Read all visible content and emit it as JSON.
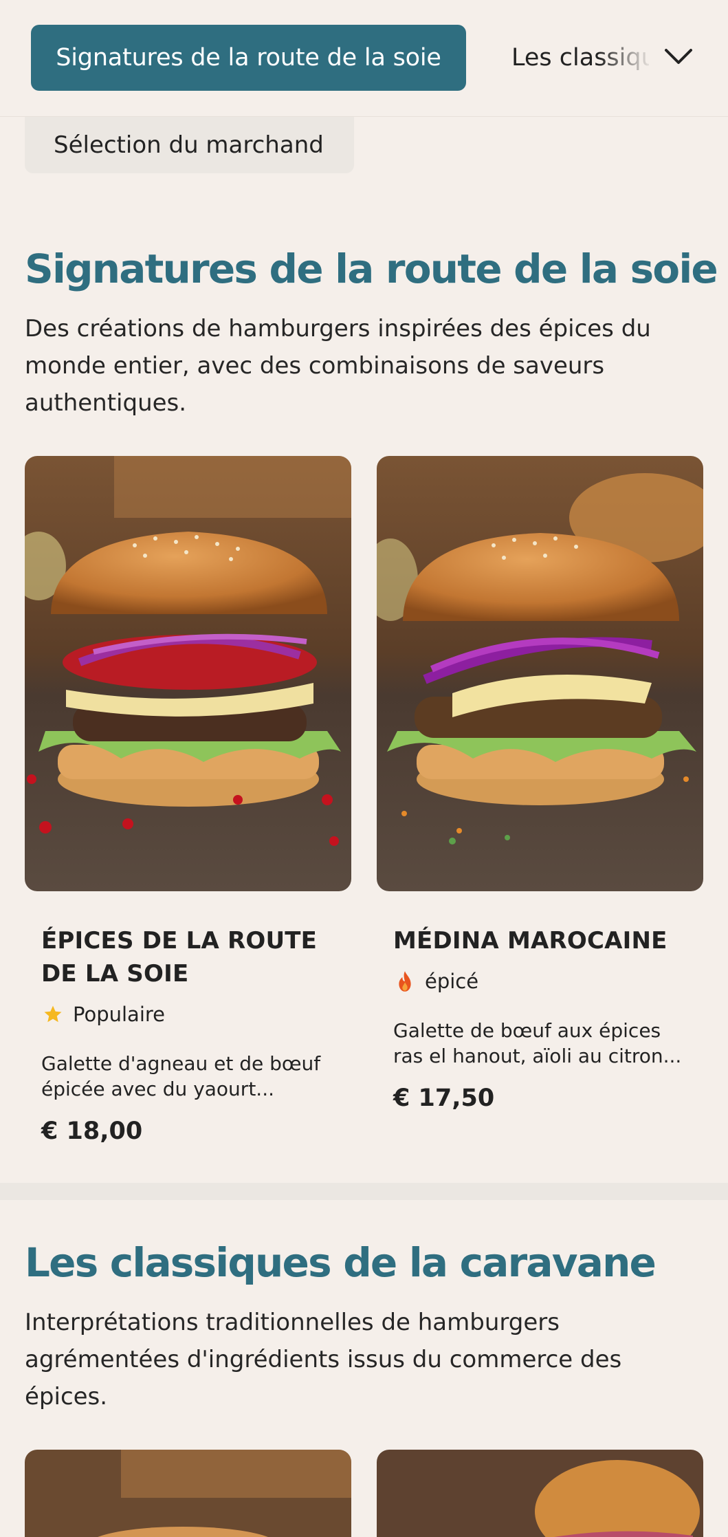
{
  "nav": {
    "active_tab": "Signatures de la route de la soie",
    "next_tab": "Les classiques de la caravane",
    "second_row_tab": "Sélection du marchand"
  },
  "sections": [
    {
      "title": "Signatures de la route de la soie",
      "description": "Des créations de hamburgers inspirées des épices du monde entier, avec des combinaisons de saveurs authentiques.",
      "items": [
        {
          "name_line1": "ÉPICES DE LA ROUTE",
          "name_line2": "DE LA SOIE",
          "badge": "Populaire",
          "badge_icon": "star-icon",
          "desc_line1": "Galette d'agneau et de bœuf",
          "desc_line2": "épicée avec du yaourt...",
          "price": "€ 18,00"
        },
        {
          "name_line1": "MÉDINA MAROCAINE",
          "badge": "épicé",
          "badge_icon": "flame-icon",
          "desc_line1": "Galette de bœuf aux épices",
          "desc_line2": "ras el hanout, aïoli au citron...",
          "price": "€ 17,50"
        }
      ]
    },
    {
      "title": "Les classiques de la caravane",
      "description": "Interprétations traditionnelles de hamburgers agrémentées d'ingrédients issus du commerce des épices."
    }
  ],
  "colors": {
    "accent": "#2f6e80",
    "background": "#f5efea",
    "star": "#f5b820",
    "flame": "#e8541e"
  }
}
